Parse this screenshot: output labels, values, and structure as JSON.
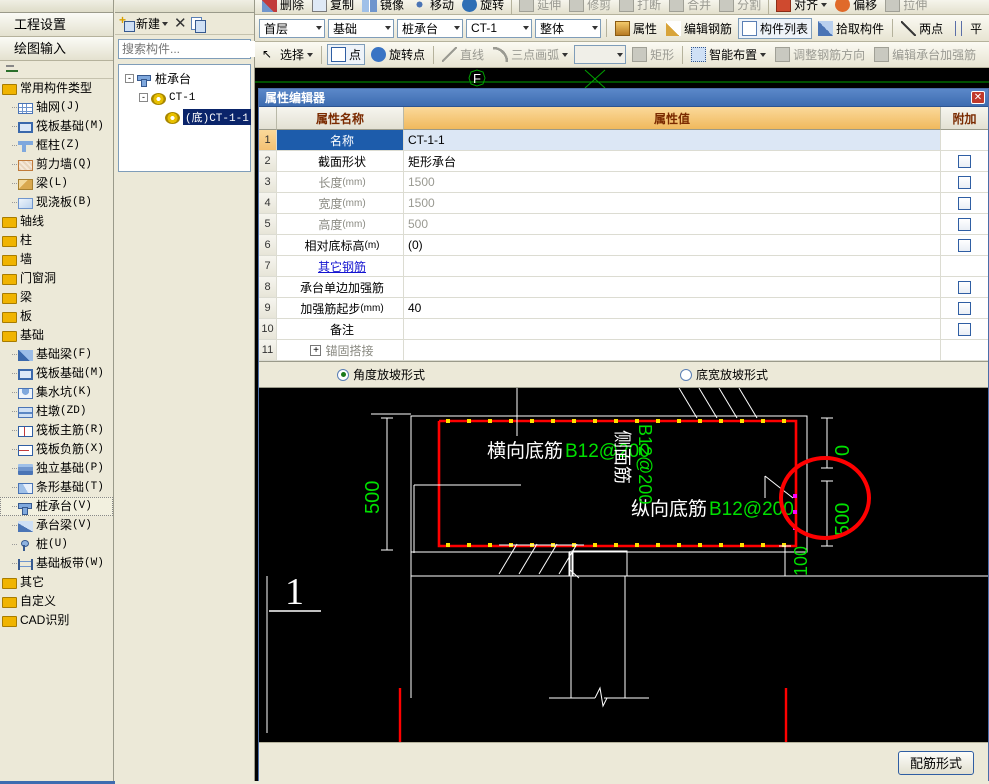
{
  "left_panel": {
    "head_buttons": [
      {
        "label": "工程设置",
        "name": "project-settings"
      },
      {
        "label": "绘图输入",
        "name": "drawing-input"
      }
    ],
    "tree": [
      {
        "label_cn": "常用构件类型",
        "label_en": "",
        "icon": "folder-icon",
        "level": 0,
        "type": "group"
      },
      {
        "label_cn": "轴网",
        "label_en": "(J)",
        "icon": "grid-icon",
        "level": 1,
        "type": "item"
      },
      {
        "label_cn": "筏板基础",
        "label_en": "(M)",
        "icon": "raft-icon",
        "level": 1,
        "type": "item"
      },
      {
        "label_cn": "框柱",
        "label_en": "(Z)",
        "icon": "column-icon",
        "level": 1,
        "type": "item"
      },
      {
        "label_cn": "剪力墙",
        "label_en": "(Q)",
        "icon": "shearwall-icon",
        "level": 1,
        "type": "item"
      },
      {
        "label_cn": "梁",
        "label_en": "(L)",
        "icon": "beam-icon",
        "level": 1,
        "type": "item"
      },
      {
        "label_cn": "现浇板",
        "label_en": "(B)",
        "icon": "slab-icon",
        "level": 1,
        "type": "item"
      },
      {
        "label_cn": "轴线",
        "label_en": "",
        "icon": "folder-icon",
        "level": 0,
        "type": "group"
      },
      {
        "label_cn": "柱",
        "label_en": "",
        "icon": "folder-icon",
        "level": 0,
        "type": "group"
      },
      {
        "label_cn": "墙",
        "label_en": "",
        "icon": "folder-icon",
        "level": 0,
        "type": "group"
      },
      {
        "label_cn": "门窗洞",
        "label_en": "",
        "icon": "folder-icon",
        "level": 0,
        "type": "group"
      },
      {
        "label_cn": "梁",
        "label_en": "",
        "icon": "folder-icon",
        "level": 0,
        "type": "group"
      },
      {
        "label_cn": "板",
        "label_en": "",
        "icon": "folder-icon",
        "level": 0,
        "type": "group"
      },
      {
        "label_cn": "基础",
        "label_en": "",
        "icon": "folder-icon",
        "level": 0,
        "type": "group"
      },
      {
        "label_cn": "基础梁",
        "label_en": "(F)",
        "icon": "foundation-beam-icon",
        "level": 1,
        "type": "item"
      },
      {
        "label_cn": "筏板基础",
        "label_en": "(M)",
        "icon": "raft-icon",
        "level": 1,
        "type": "item"
      },
      {
        "label_cn": "集水坑",
        "label_en": "(K)",
        "icon": "sump-pit-icon",
        "level": 1,
        "type": "item"
      },
      {
        "label_cn": "柱墩",
        "label_en": "(ZD)",
        "icon": "pier-icon",
        "level": 1,
        "type": "item"
      },
      {
        "label_cn": "筏板主筋",
        "label_en": "(R)",
        "icon": "raft-main-rebar-icon",
        "level": 1,
        "type": "item"
      },
      {
        "label_cn": "筏板负筋",
        "label_en": "(X)",
        "icon": "raft-neg-rebar-icon",
        "level": 1,
        "type": "item"
      },
      {
        "label_cn": "独立基础",
        "label_en": "(P)",
        "icon": "isolated-footing-icon",
        "level": 1,
        "type": "item"
      },
      {
        "label_cn": "条形基础",
        "label_en": "(T)",
        "icon": "strip-footing-icon",
        "level": 1,
        "type": "item"
      },
      {
        "label_cn": "桩承台",
        "label_en": "(V)",
        "icon": "pile-cap-icon",
        "level": 1,
        "type": "item",
        "selected": true
      },
      {
        "label_cn": "承台梁",
        "label_en": "(V)",
        "icon": "cap-beam-icon",
        "level": 1,
        "type": "item"
      },
      {
        "label_cn": "桩",
        "label_en": "(U)",
        "icon": "pile-icon",
        "level": 1,
        "type": "item"
      },
      {
        "label_cn": "基础板带",
        "label_en": "(W)",
        "icon": "slab-band-icon",
        "level": 1,
        "type": "item"
      },
      {
        "label_cn": "其它",
        "label_en": "",
        "icon": "folder-icon",
        "level": 0,
        "type": "group"
      },
      {
        "label_cn": "自定义",
        "label_en": "",
        "icon": "folder-icon",
        "level": 0,
        "type": "group"
      },
      {
        "label_cn": "CAD识别",
        "label_en": "",
        "icon": "folder-icon",
        "level": 0,
        "type": "group"
      }
    ]
  },
  "component_list": {
    "toolbar": {
      "new_label": "新建",
      "delete_name": "delete-icon",
      "copy_name": "copy-icon"
    },
    "search": {
      "placeholder": "搜索构件..."
    },
    "tree": [
      {
        "label": "桩承台",
        "level": 1,
        "expander": "-",
        "icon": "pile-cap-icon"
      },
      {
        "label": "CT-1",
        "level": 2,
        "expander": "-",
        "icon": "gear-icon"
      },
      {
        "label": "(底)CT-1-1",
        "level": 3,
        "expander": "",
        "icon": "gear-icon",
        "selected": true
      }
    ]
  },
  "toolbars": {
    "row0": [
      {
        "label": "删除",
        "icon": "delete-icon",
        "disabled": false
      },
      {
        "label": "复制",
        "icon": "copy-icon",
        "disabled": false
      },
      {
        "label": "镜像",
        "icon": "mirror-icon",
        "disabled": false
      },
      {
        "label": "移动",
        "icon": "move-icon",
        "disabled": false
      },
      {
        "label": "旋转",
        "icon": "rotate-icon",
        "disabled": false
      },
      {
        "label": "延伸",
        "icon": "extend-icon",
        "disabled": true
      },
      {
        "label": "修剪",
        "icon": "trim-icon",
        "disabled": true
      },
      {
        "label": "打断",
        "icon": "break-icon",
        "disabled": true
      },
      {
        "label": "合并",
        "icon": "merge-icon",
        "disabled": true
      },
      {
        "label": "分割",
        "icon": "split-icon",
        "disabled": true
      },
      {
        "label": "对齐",
        "icon": "align-icon",
        "disabled": false,
        "dropdown": true
      },
      {
        "label": "偏移",
        "icon": "offset-icon",
        "disabled": false
      },
      {
        "label": "拉伸",
        "icon": "stretch-icon",
        "disabled": true
      }
    ],
    "row1_combos": [
      {
        "value": "首层",
        "name": "floor-select"
      },
      {
        "value": "基础",
        "name": "category-select"
      },
      {
        "value": "桩承台",
        "name": "component-type-select"
      },
      {
        "value": "CT-1",
        "name": "component-select"
      },
      {
        "value": "整体",
        "name": "view-mode-select"
      }
    ],
    "row1_buttons": [
      {
        "label": "属性",
        "icon": "property-icon"
      },
      {
        "label": "编辑钢筋",
        "icon": "edit-rebar-icon"
      },
      {
        "label": "构件列表",
        "icon": "component-list-icon",
        "framed": true
      },
      {
        "label": "拾取构件",
        "icon": "pick-component-icon"
      },
      {
        "label": "两点",
        "icon": "two-point-icon"
      },
      {
        "label": "平",
        "icon": "parallel-icon"
      }
    ],
    "row2": [
      {
        "label": "选择",
        "icon": "select-icon",
        "dropdown": true,
        "disabled": false
      },
      {
        "label": "点",
        "icon": "point-icon",
        "disabled": false,
        "framed": true
      },
      {
        "label": "旋转点",
        "icon": "rotate-point-icon",
        "disabled": false
      },
      {
        "label": "直线",
        "icon": "line-icon",
        "disabled": true
      },
      {
        "label": "三点画弧",
        "icon": "three-point-arc-icon",
        "disabled": true,
        "dropdown": true
      },
      {
        "label": "矩形",
        "icon": "rectangle-icon",
        "disabled": true
      },
      {
        "label": "智能布置",
        "icon": "smart-layout-icon",
        "disabled": false,
        "dropdown": true
      },
      {
        "label": "调整钢筋方向",
        "icon": "adjust-rebar-direction-icon",
        "disabled": true
      },
      {
        "label": "编辑承台加强筋",
        "icon": "edit-cap-rebar-icon",
        "disabled": true
      }
    ],
    "row2_empty_combo": ""
  },
  "canvas": {
    "axis_label": "F"
  },
  "property_editor": {
    "title": "属性编辑器",
    "close_name": "close-icon",
    "columns": {
      "index": "",
      "name": "属性名称",
      "value": "属性值",
      "attach": "附加"
    },
    "rows": [
      {
        "n": "1",
        "name": "名称",
        "unit": "",
        "value": "CT-1-1",
        "selected": true,
        "checkbox": false,
        "name_style": "normal",
        "value_style": "normal"
      },
      {
        "n": "2",
        "name": "截面形状",
        "unit": "",
        "value": "矩形承台",
        "selected": false,
        "checkbox": true,
        "name_style": "normal",
        "value_style": "normal"
      },
      {
        "n": "3",
        "name": "长度",
        "unit": "(mm)",
        "value": "1500",
        "selected": false,
        "checkbox": true,
        "name_style": "gray",
        "value_style": "gray"
      },
      {
        "n": "4",
        "name": "宽度",
        "unit": "(mm)",
        "value": "1500",
        "selected": false,
        "checkbox": true,
        "name_style": "gray",
        "value_style": "gray"
      },
      {
        "n": "5",
        "name": "高度",
        "unit": "(mm)",
        "value": "500",
        "selected": false,
        "checkbox": true,
        "name_style": "gray",
        "value_style": "gray"
      },
      {
        "n": "6",
        "name": "相对底标高",
        "unit": "(m)",
        "value": "(0)",
        "selected": false,
        "checkbox": true,
        "name_style": "normal",
        "value_style": "normal"
      },
      {
        "n": "7",
        "name": "其它钢筋",
        "unit": "",
        "value": "",
        "selected": false,
        "checkbox": false,
        "name_style": "link",
        "value_style": "normal"
      },
      {
        "n": "8",
        "name": "承台单边加强筋",
        "unit": "",
        "value": "",
        "selected": false,
        "checkbox": true,
        "name_style": "normal",
        "value_style": "normal"
      },
      {
        "n": "9",
        "name": "加强筋起步",
        "unit": "(mm)",
        "value": "40",
        "selected": false,
        "checkbox": true,
        "name_style": "normal",
        "value_style": "normal"
      },
      {
        "n": "10",
        "name": "备注",
        "unit": "",
        "value": "",
        "selected": false,
        "checkbox": true,
        "name_style": "normal",
        "value_style": "normal"
      },
      {
        "n": "11",
        "name": "锚固搭接",
        "unit": "",
        "value": "",
        "selected": false,
        "checkbox": false,
        "name_style": "gray",
        "value_style": "normal",
        "expandable": true
      }
    ],
    "radios": [
      {
        "label": "角度放坡形式",
        "checked": true,
        "name": "slope-angle-radio"
      },
      {
        "label": "底宽放坡形式",
        "checked": false,
        "name": "slope-bottom-width-radio"
      }
    ],
    "footer": {
      "button_label": "配筋形式",
      "button_name": "rebar-form-button"
    }
  },
  "diagram": {
    "annotations": {
      "transverse_bottom_rebar": "横向底筋",
      "transverse_bottom_rebar_spec": "B12@200",
      "longitudinal_bottom_rebar": "纵向底筋",
      "longitudinal_bottom_rebar_spec": "B12@200",
      "side_rebar": "侧面筋",
      "side_rebar_spec": "B12@200",
      "dim_left": "500",
      "dim_right_top": "0",
      "dim_right_bottom": "500",
      "dim_bottom": "100",
      "section_marker": "1"
    },
    "colors": {
      "cap_outline": "#ff0000",
      "rebar_dot": "#ffe000",
      "text_green": "#00e000",
      "text_white": "#ffffff",
      "highlight_circle": "#ff0000",
      "magenta_dot": "#ff00ff"
    }
  }
}
